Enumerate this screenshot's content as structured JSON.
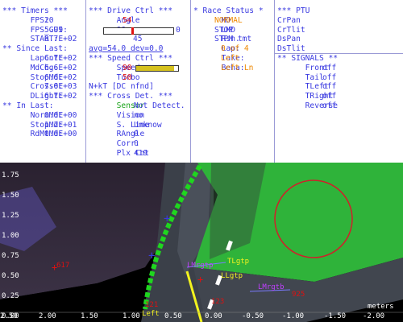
{
  "timers": {
    "header": "*** Timers ***",
    "fps_label": "FPS:",
    "fps_value": "20",
    "fpsgui_label": "FPS_GUI:",
    "fpsgui_value": "5.99",
    "start_label": "START:",
    "start_value": "6.7E+02",
    "since_header": "** Since Last:",
    "since": [
      {
        "label": "LapCnt:",
        "value": "6.7E+02"
      },
      {
        "label": "MdChg:",
        "value": "6.6E+02"
      },
      {
        "label": "StopMd:",
        "value": "6.6E+02"
      },
      {
        "label": "Cross0:",
        "value": "7.6E+03"
      },
      {
        "label": "DLight:",
        "value": "6.7E+02"
      }
    ],
    "in_header": "** In Last:",
    "in_last": [
      {
        "label": "NormMd:",
        "value": "0.0E+00"
      },
      {
        "label": "StopMd:",
        "value": "1.2E+01"
      },
      {
        "label": "RdMtMd:",
        "value": "0.0E+00"
      }
    ]
  },
  "drive": {
    "header": "*** Drive Ctrl ***",
    "angle_label": "Angle",
    "angle_value": "54",
    "angle_min": "90",
    "angle_max": "0",
    "angle_mid": "45",
    "angle_level": 0.4,
    "avg_text": "avg=54.0 dev=0.0",
    "speed_header": "*** Speed Ctrl ***",
    "speed_label": "Speed",
    "speed_value": "90",
    "speed_level": 0.9,
    "turbo_label": "Turbo",
    "turbo_value": "50",
    "nkt_text": "N+kT [DC nfnd]",
    "cross_header": "*** Cross Det. ***",
    "cross_rows": [
      {
        "label": "Sensor",
        "value": "Not Detect."
      },
      {
        "label": "Vision",
        "value": "no"
      },
      {
        "label": "S. Line",
        "value": "Unknow"
      },
      {
        "label": "RAngle",
        "value": "0"
      },
      {
        "label": "Corr.",
        "value": "0"
      },
      {
        "label": "Plx Cnt",
        "value": "419"
      }
    ]
  },
  "race": {
    "header": "* Race Status *",
    "rows": [
      {
        "label": "MD",
        "value": "NORMAL"
      },
      {
        "label": "LMD",
        "value": "STOP"
      },
      {
        "label": "Rsn.",
        "value": "STPM tmt"
      },
      {
        "label": "Lap:",
        "value": "0 of 4"
      },
      {
        "label": "Take:",
        "value": "Left"
      },
      {
        "label": "Beha:",
        "value": "Left Ln"
      }
    ]
  },
  "ptu": {
    "header": "*** PTU",
    "items": [
      "CrPan",
      "CrTlit",
      "DsPan",
      "DsTlit"
    ],
    "signals_header": "** SIGNALS **",
    "signals": [
      {
        "label": "Front",
        "value": "off"
      },
      {
        "label": "Tail",
        "value": "off"
      },
      {
        "label": "TLeft",
        "value": "off"
      },
      {
        "label": "TRight",
        "value": "off"
      },
      {
        "label": "Reverse",
        "value": "off"
      }
    ]
  },
  "camera": {
    "y_ticks": [
      "1.75",
      "1.50",
      "1.25",
      "1.00",
      "0.75",
      "0.50",
      "0.25",
      "0.00"
    ],
    "x_ticks": [
      "2.50",
      "2.00",
      "1.50",
      "1.00",
      "0.50",
      "0.00",
      "-0.50",
      "-1.00",
      "-1.50",
      "-2.00"
    ],
    "units_label": "meters",
    "labels": {
      "p617": "617",
      "p121": "121",
      "left": "Left",
      "p123": "123",
      "p925": "925",
      "lmrgtp": "LMrgtp",
      "tlgtp": "TLgtp",
      "llgtp": "LLgtp",
      "lmrgtb": "LMrgtb"
    },
    "colors": {
      "grass": "#2fb33a",
      "track": "#3b4049",
      "lane": "#1fd61f",
      "circle": "#d0202a"
    }
  }
}
